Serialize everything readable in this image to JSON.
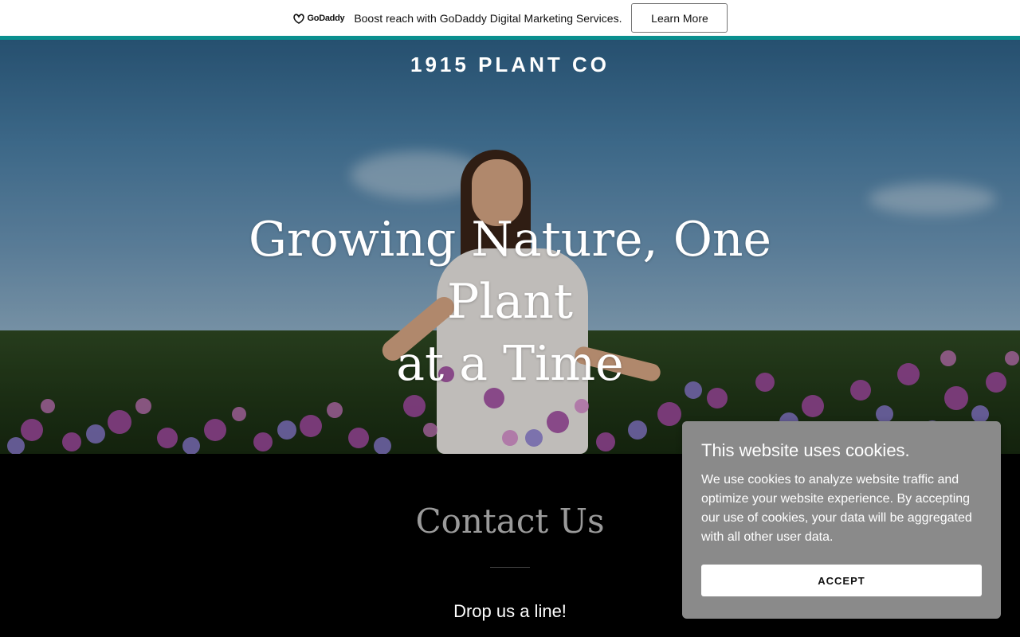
{
  "promo": {
    "logo_text": "GoDaddy",
    "message": "Boost reach with GoDaddy Digital Marketing Services.",
    "cta_label": "Learn More"
  },
  "hero": {
    "brand": "1915 PLANT CO",
    "headline_line1": "Growing Nature, One Plant",
    "headline_line2": "at a Time"
  },
  "contact": {
    "title": "Contact Us",
    "subtitle": "Drop us a line!"
  },
  "cookie_banner": {
    "title": "This website uses cookies.",
    "body": "We use cookies to analyze website traffic and optimize your website experience. By accepting our use of cookies, your data will be aggregated with all other user data.",
    "accept_label": "ACCEPT"
  },
  "colors": {
    "accent_line": "#0a8f8f",
    "cookie_bg": "#8a8a8a",
    "contact_bg": "#000000"
  }
}
